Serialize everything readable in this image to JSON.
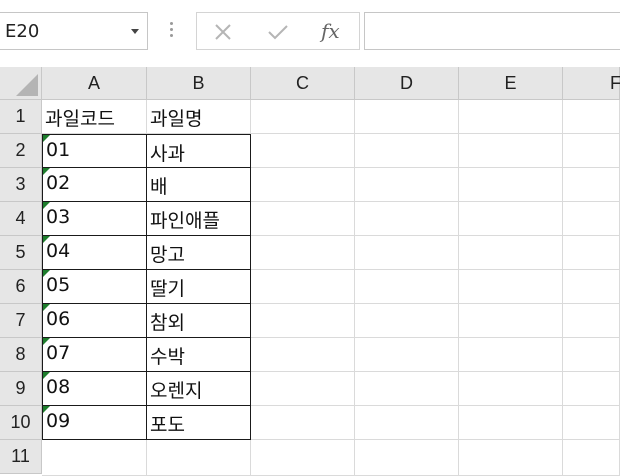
{
  "name_box": {
    "value": "E20"
  },
  "formula_bar": {
    "cancel_icon": "close-icon",
    "enter_icon": "check-icon",
    "fx_label": "fx",
    "content": ""
  },
  "columns": [
    "A",
    "B",
    "C",
    "D",
    "E",
    "F"
  ],
  "rows": [
    "1",
    "2",
    "3",
    "4",
    "5",
    "6",
    "7",
    "8",
    "9",
    "10",
    "11"
  ],
  "table": {
    "header": {
      "a": "과일코드",
      "b": "과일명"
    },
    "rows": [
      {
        "code": "01",
        "name": "사과"
      },
      {
        "code": "02",
        "name": "배"
      },
      {
        "code": "03",
        "name": "파인애플"
      },
      {
        "code": "04",
        "name": "망고"
      },
      {
        "code": "05",
        "name": "딸기"
      },
      {
        "code": "06",
        "name": "참외"
      },
      {
        "code": "07",
        "name": "수박"
      },
      {
        "code": "08",
        "name": "오렌지"
      },
      {
        "code": "09",
        "name": "포도"
      }
    ]
  },
  "colors": {
    "header_bg": "#e6e6e6",
    "gridline": "#dadada",
    "error_flag": "#1d7d2c"
  }
}
